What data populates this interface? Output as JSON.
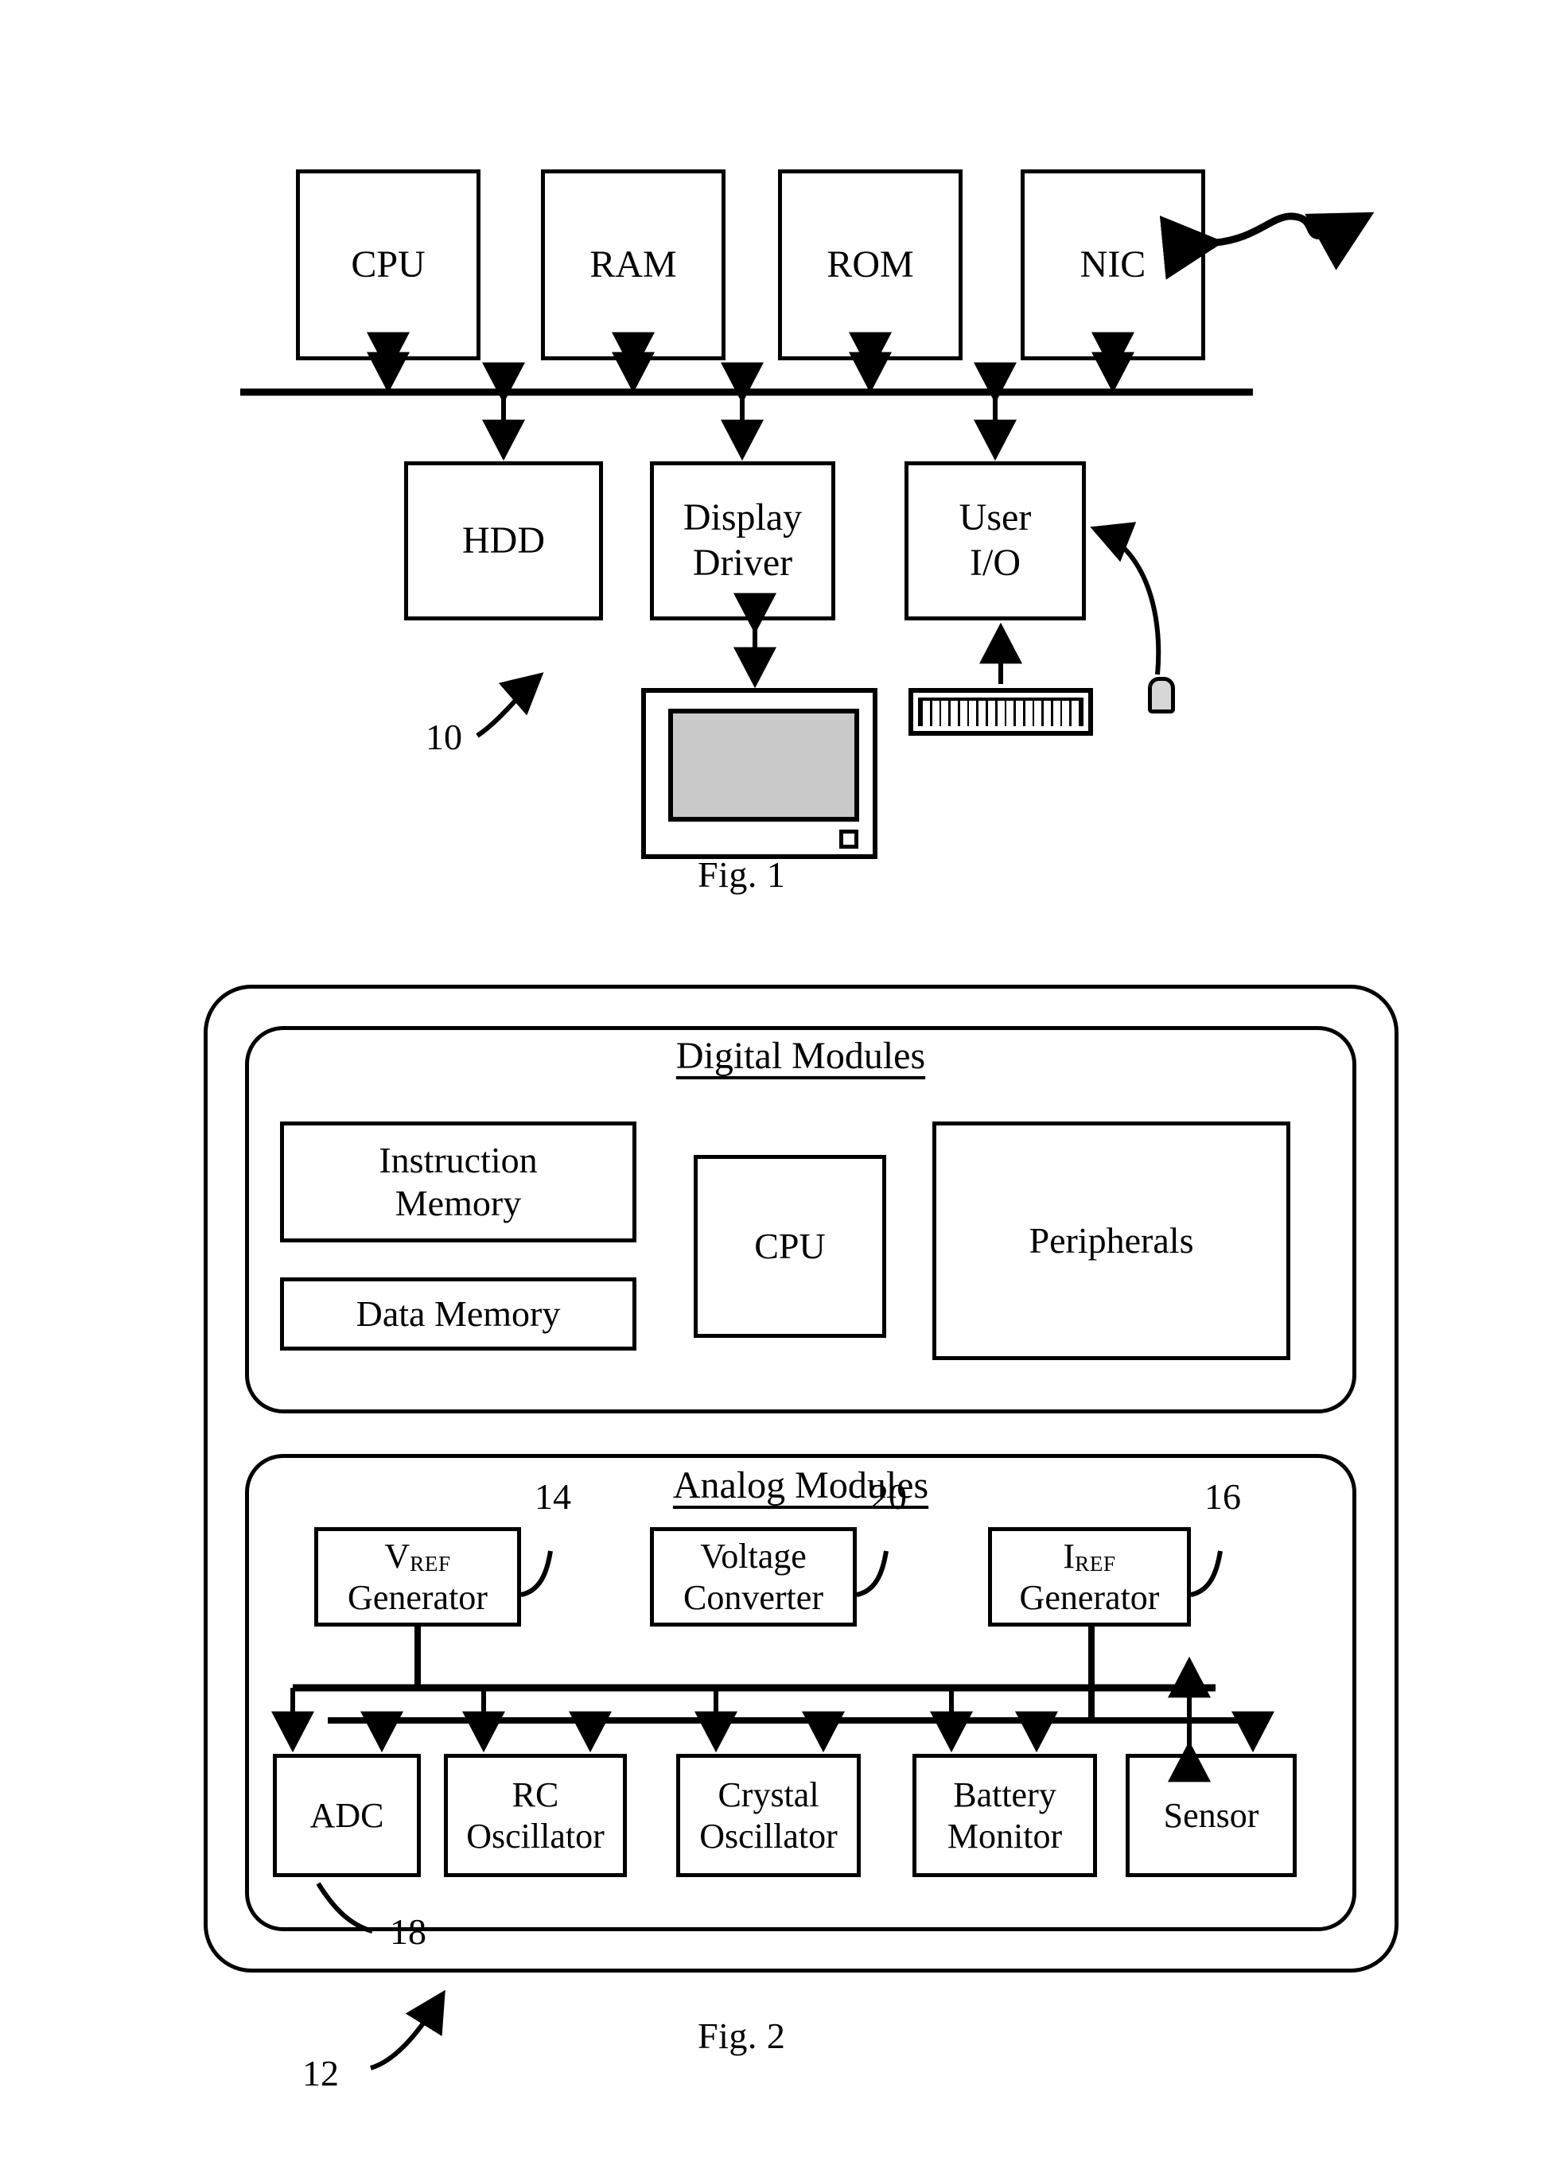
{
  "figure1": {
    "caption": "Fig. 1",
    "ref_numeral": "10",
    "top_row": [
      {
        "label": "CPU"
      },
      {
        "label": "RAM"
      },
      {
        "label": "ROM"
      },
      {
        "label": "NIC"
      }
    ],
    "bottom_row": [
      {
        "label": "HDD"
      },
      {
        "label": "Display\nDriver",
        "line1": "Display",
        "line2": "Driver"
      },
      {
        "label": "User\nI/O",
        "line1": "User",
        "line2": "I/O"
      }
    ],
    "peripherals": {
      "monitor": "monitor-device",
      "keyboard": "keyboard-device",
      "mouse": "mouse-device"
    },
    "nic_antenna": "wireless-link-arrow"
  },
  "figure2": {
    "caption": "Fig. 2",
    "ref_numeral": "12",
    "digital": {
      "title": "Digital Modules",
      "blocks": [
        {
          "id": "instruction-memory",
          "line1": "Instruction",
          "line2": "Memory"
        },
        {
          "id": "data-memory",
          "line1": "Data Memory",
          "line2": ""
        },
        {
          "id": "cpu",
          "line1": "CPU",
          "line2": ""
        },
        {
          "id": "peripherals",
          "line1": "Peripherals",
          "line2": ""
        }
      ]
    },
    "analog": {
      "title": "Analog Modules",
      "sources": [
        {
          "id": "vref-generator",
          "symbol": "V",
          "subscript": "REF",
          "line2": "Generator",
          "ref": "14"
        },
        {
          "id": "voltage-converter",
          "symbol": "",
          "subscript": "",
          "line1": "Voltage",
          "line2": "Converter",
          "ref": "20"
        },
        {
          "id": "iref-generator",
          "symbol": "I",
          "subscript": "REF",
          "line2": "Generator",
          "ref": "16"
        }
      ],
      "consumers": [
        {
          "id": "adc",
          "line1": "ADC",
          "line2": "",
          "ref": "18"
        },
        {
          "id": "rc-oscillator",
          "line1": "RC",
          "line2": "Oscillator",
          "ref": ""
        },
        {
          "id": "crystal-oscillator",
          "line1": "Crystal",
          "line2": "Oscillator",
          "ref": ""
        },
        {
          "id": "battery-monitor",
          "line1": "Battery",
          "line2": "Monitor",
          "ref": ""
        },
        {
          "id": "sensor",
          "line1": "Sensor",
          "line2": "",
          "ref": ""
        }
      ]
    }
  },
  "colors": {
    "ink": "#000000",
    "screen_fill": "#c9c9c9",
    "mouse_fill": "#d7d7d7",
    "page": "#ffffff"
  }
}
